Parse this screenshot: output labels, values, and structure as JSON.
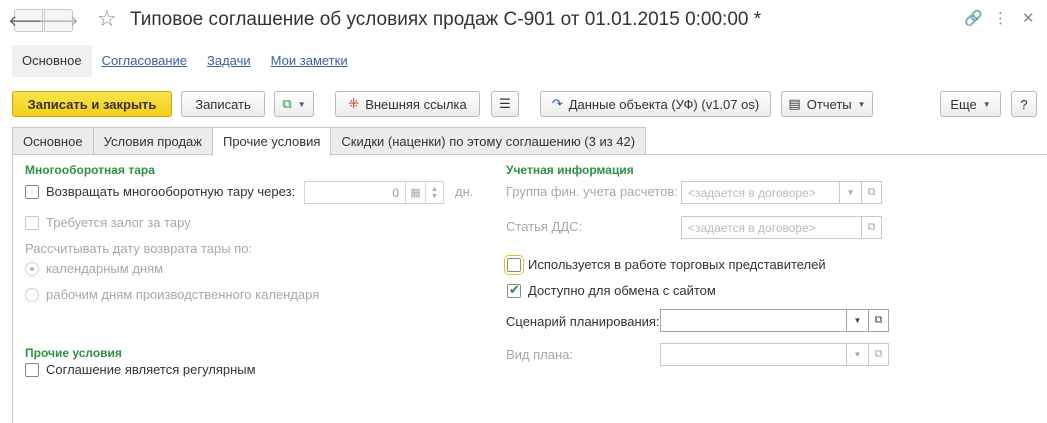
{
  "window": {
    "title": "Типовое соглашение об условиях продаж С-901 от 01.01.2015 0:00:00 *"
  },
  "subnav": [
    {
      "label": "Основное"
    },
    {
      "label": "Согласование"
    },
    {
      "label": "Задачи"
    },
    {
      "label": "Мои заметки"
    }
  ],
  "toolbar": {
    "save_close": "Записать и закрыть",
    "save": "Записать",
    "external_link": "Внешняя ссылка",
    "object_data": "Данные объекта (УФ) (v1.07 os)",
    "reports": "Отчеты",
    "more": "Еще",
    "help": "?"
  },
  "tabs": [
    {
      "label": "Основное"
    },
    {
      "label": "Условия продаж"
    },
    {
      "label": "Прочие условия"
    },
    {
      "label": "Скидки (наценки) по этому соглашению (3 из 42)"
    }
  ],
  "left": {
    "section_tare": "Многооборотная тара",
    "return_tare_label": "Возвращать многооборотную тару через:",
    "return_days_value": "0",
    "days_unit": "дн.",
    "deposit_label": "Требуется залог за тару",
    "calc_date_label": "Рассчитывать дату возврата тары по:",
    "radio_calendar": "календарным дням",
    "radio_work": "рабочим дням производственного календаря",
    "section_other": "Прочие условия",
    "regular_label": "Соглашение является регулярным"
  },
  "right": {
    "section_accounting": "Учетная информация",
    "fin_group_label": "Группа фин. учета расчетов:",
    "fin_group_placeholder": "<задается в договоре>",
    "dds_label": "Статья ДДС:",
    "dds_placeholder": "<задается в договоре>",
    "sales_reps_label": "Используется в работе торговых представителей",
    "site_exchange_label": "Доступно для обмена с сайтом",
    "scenario_label": "Сценарий планирования:",
    "scenario_value": "",
    "plan_type_label": "Вид плана:",
    "plan_type_value": ""
  }
}
